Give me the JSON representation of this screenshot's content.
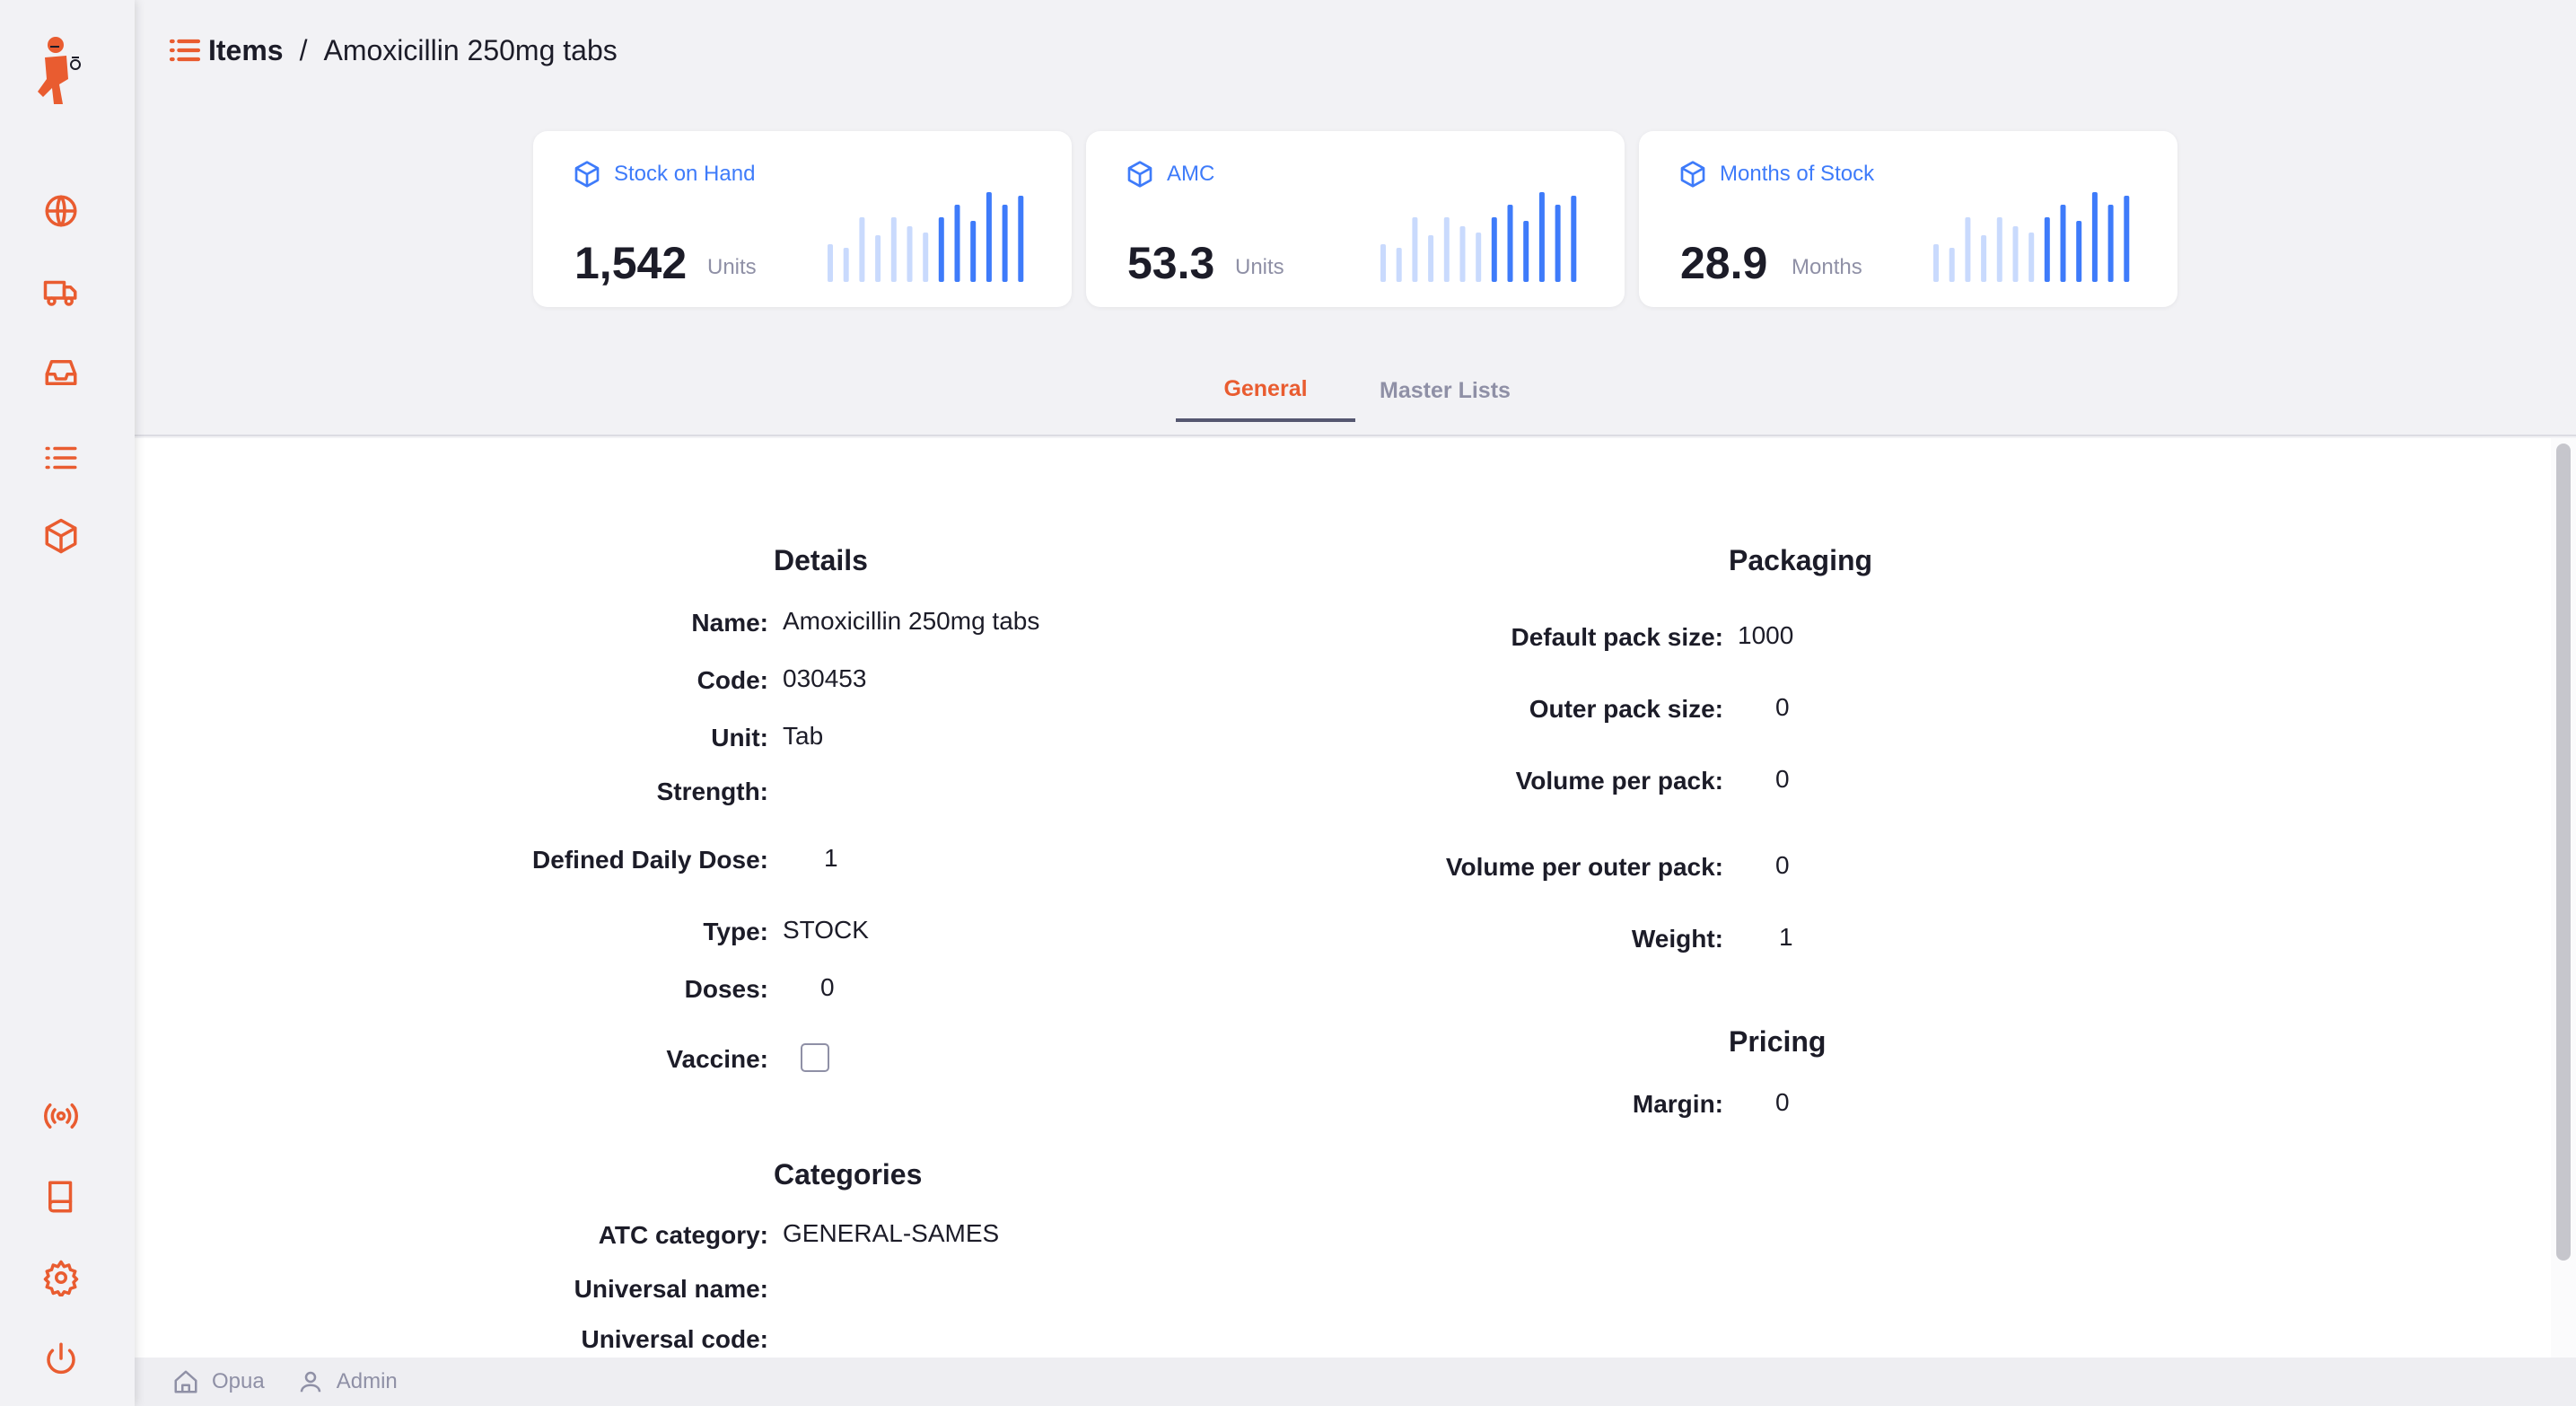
{
  "breadcrumb": {
    "section": "Items",
    "separator": "/",
    "current": "Amoxicillin 250mg tabs"
  },
  "nav": {
    "items": [
      {
        "name": "globe-icon"
      },
      {
        "name": "truck-icon"
      },
      {
        "name": "inbox-icon"
      },
      {
        "name": "list-icon"
      },
      {
        "name": "package-icon"
      }
    ],
    "bottom": [
      {
        "name": "broadcast-icon"
      },
      {
        "name": "book-icon"
      },
      {
        "name": "gear-icon"
      },
      {
        "name": "power-icon"
      }
    ]
  },
  "stats": [
    {
      "title": "Stock on Hand",
      "value": "1,542",
      "unit": "Units",
      "bars": [
        0.42,
        0.38,
        0.72,
        0.52,
        0.72,
        0.62,
        0.55,
        0.72,
        0.86,
        0.68,
        1.0,
        0.86,
        0.96
      ]
    },
    {
      "title": "AMC",
      "value": "53.3",
      "unit": "Units",
      "bars": [
        0.42,
        0.38,
        0.72,
        0.52,
        0.72,
        0.62,
        0.55,
        0.72,
        0.86,
        0.68,
        1.0,
        0.86,
        0.96
      ]
    },
    {
      "title": "Months of Stock",
      "value": "28.9",
      "unit": "Months",
      "bars": [
        0.42,
        0.38,
        0.72,
        0.52,
        0.72,
        0.62,
        0.55,
        0.72,
        0.86,
        0.68,
        1.0,
        0.86,
        0.96
      ]
    }
  ],
  "colors": {
    "accent": "#e95c30",
    "blue": "#3e7bfa",
    "blue_light": "#c9dafd"
  },
  "tabs": {
    "general": "General",
    "master_lists": "Master Lists"
  },
  "details": {
    "title": "Details",
    "name_label": "Name:",
    "name": "Amoxicillin 250mg tabs",
    "code_label": "Code:",
    "code": "030453",
    "unit_label": "Unit:",
    "unit": "Tab",
    "strength_label": "Strength:",
    "strength": "",
    "ddd_label": "Defined Daily Dose:",
    "ddd": "1",
    "type_label": "Type:",
    "type": "STOCK",
    "doses_label": "Doses:",
    "doses": "0",
    "vaccine_label": "Vaccine:",
    "vaccine_checked": false
  },
  "categories": {
    "title": "Categories",
    "atc_label": "ATC category:",
    "atc": "GENERAL-SAMES",
    "universal_name_label": "Universal name:",
    "universal_name": "",
    "universal_code_label": "Universal code:",
    "universal_code": ""
  },
  "packaging": {
    "title": "Packaging",
    "default_pack_label": "Default pack size:",
    "default_pack": "1000",
    "outer_pack_label": "Outer pack size:",
    "outer_pack": "0",
    "volume_label": "Volume per pack:",
    "volume": "0",
    "volume_outer_label": "Volume per outer pack:",
    "volume_outer": "0",
    "weight_label": "Weight:",
    "weight": "1"
  },
  "pricing": {
    "title": "Pricing",
    "margin_label": "Margin:",
    "margin": "0"
  },
  "footer": {
    "store": "Opua",
    "user": "Admin"
  }
}
